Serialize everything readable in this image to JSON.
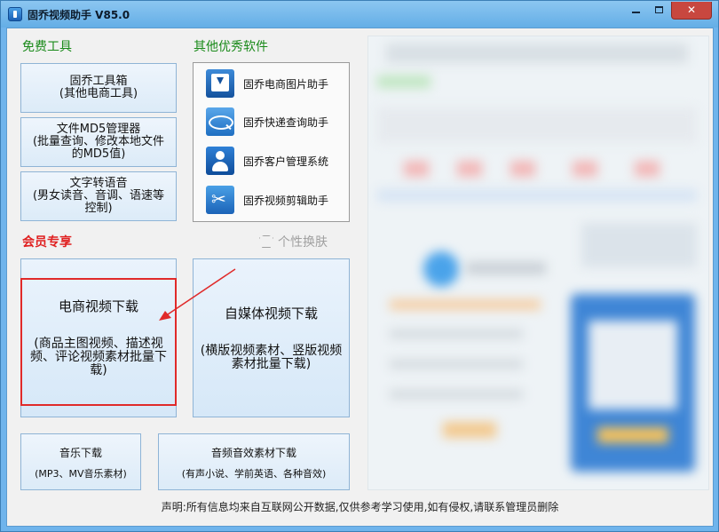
{
  "window": {
    "title": "固乔视频助手 V85.0",
    "close_glyph": "✕"
  },
  "sections": {
    "free_tools": "免费工具",
    "other_software": "其他优秀软件",
    "member": "会员专享"
  },
  "free_tools": {
    "toolbox": {
      "line1": "固乔工具箱",
      "line2": "(其他电商工具)"
    },
    "md5": {
      "line1": "文件MD5管理器",
      "line2": "(批量查询、修改本地文件",
      "line3": "的MD5值)"
    },
    "tts": {
      "line1": "文字转语音",
      "line2": "(男女读音、音调、语速等",
      "line3": "控制)"
    }
  },
  "other_software": [
    {
      "label": "固乔电商图片助手",
      "icon": "download-image-icon"
    },
    {
      "label": "固乔快递查询助手",
      "icon": "express-search-icon"
    },
    {
      "label": "固乔客户管理系统",
      "icon": "customer-manager-icon"
    },
    {
      "label": "固乔视频剪辑助手",
      "icon": "scissors-icon"
    }
  ],
  "skin": {
    "label": "个性换肤",
    "icon": "shirt-icon"
  },
  "member": {
    "ecom": {
      "title": "电商视频下载",
      "subtitle": "(商品主图视频、描述视频、评论视频素材批量下载)"
    },
    "media": {
      "title": "自媒体视频下载",
      "subtitle": "(横版视频素材、竖版视频素材批量下载)"
    }
  },
  "bottom": {
    "music": {
      "title": "音乐下载",
      "subtitle": "(MP3、MV音乐素材)"
    },
    "sfx": {
      "title": "音频音效素材下载",
      "subtitle": "(有声小说、学前英语、各种音效)"
    }
  },
  "footer": "声明:所有信息均来自互联网公开数据,仅供参考学习使用,如有侵权,请联系管理员删除",
  "colors": {
    "title_bar": "#6fb4ec",
    "free_title": "#1a8a1a",
    "member_title": "#e02020",
    "highlight": "#e02a2a"
  }
}
